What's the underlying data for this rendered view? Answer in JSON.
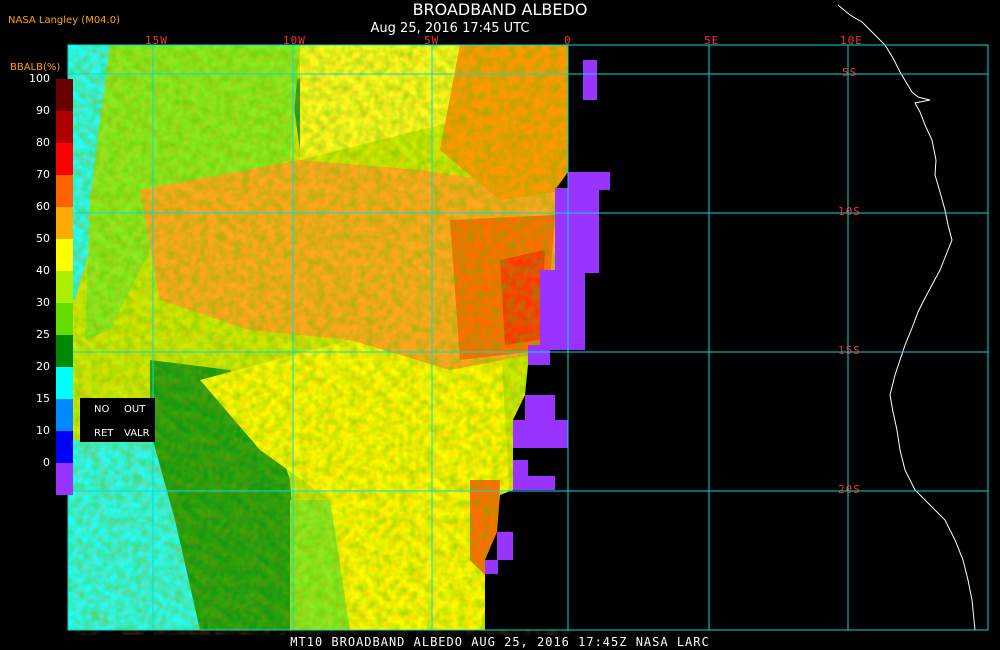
{
  "header": {
    "title": "BROADBAND ALBEDO",
    "subtitle": "Aug 25, 2016 17:45 UTC",
    "source": "NASA Langley (M04.0)"
  },
  "longitude_labels": [
    "15W",
    "10W",
    "5W",
    "0",
    "5E",
    "10E"
  ],
  "latitude_labels": [
    "5S",
    "10S",
    "15S",
    "20S"
  ],
  "legend": {
    "title": "BBALB(%)",
    "ticks": [
      "100",
      "90",
      "80",
      "70",
      "60",
      "50",
      "40",
      "30",
      "25",
      "20",
      "15",
      "10",
      "0"
    ],
    "colors": [
      "#6b0000",
      "#b00000",
      "#ff0000",
      "#ff6000",
      "#ffaa00",
      "#ffff00",
      "#aaee00",
      "#66dd00",
      "#008800",
      "#00ffff",
      "#0088ff",
      "#0000ff",
      "#9933ff"
    ],
    "nodata": {
      "no_label": "NO",
      "ret_label": "RET",
      "out_label": "OUT",
      "valr_label": "VALR"
    }
  },
  "footer": "MT10  BROADBAND ALBEDO   AUG 25, 2016 17:45Z   NASA LARC",
  "colors": {
    "grid": "#00dddd",
    "coast": "#ffffff",
    "label_red": "#ff3030",
    "source_orange": "#ffa500",
    "no_retrieval": "#9933ff"
  }
}
